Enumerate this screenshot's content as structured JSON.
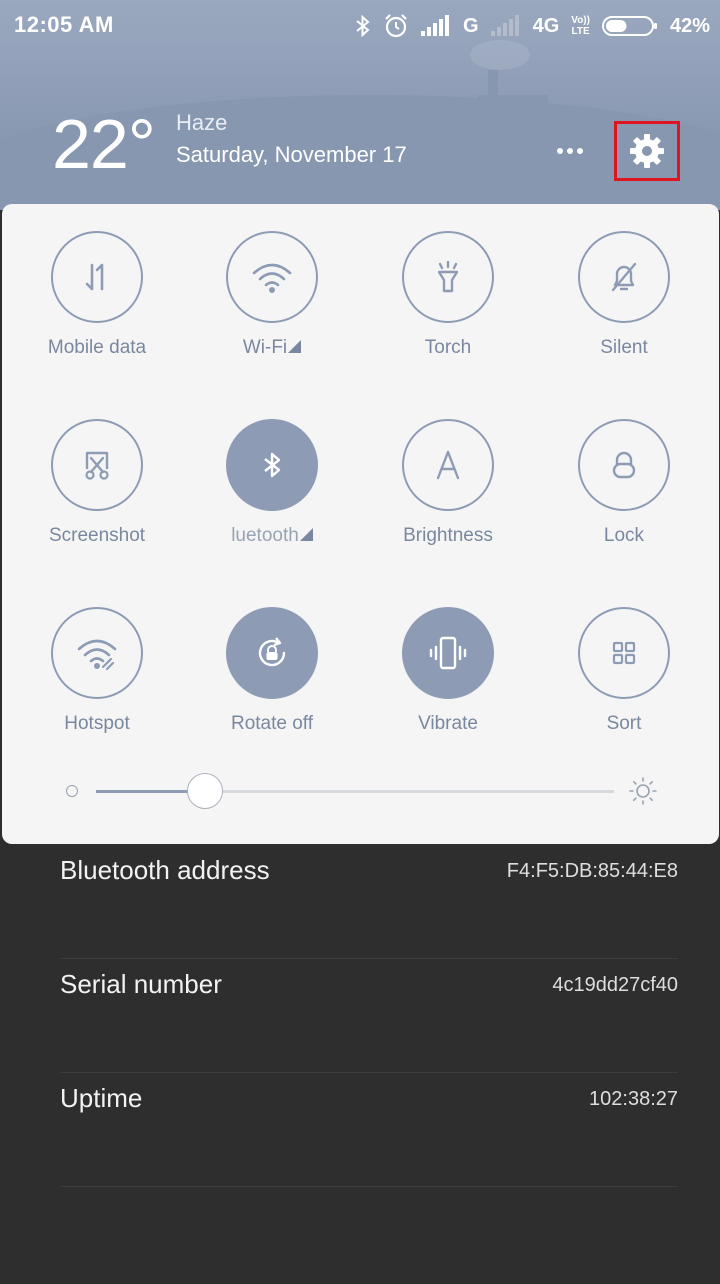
{
  "status_bar": {
    "time": "12:05 AM",
    "network_1": "G",
    "network_2": "4G",
    "volte_top": "Vo))",
    "volte_bottom": "LTE",
    "battery_percent": "42%",
    "battery_level": 0.42
  },
  "header": {
    "temperature": "22°",
    "condition": "Haze",
    "date": "Saturday, November 17"
  },
  "toggles": [
    {
      "label": "Mobile data",
      "icon": "mobile-data-icon",
      "active": false,
      "triangle": false
    },
    {
      "label": "Wi-Fi",
      "icon": "wifi-icon",
      "active": false,
      "triangle": true
    },
    {
      "label": "Torch",
      "icon": "torch-icon",
      "active": false,
      "triangle": false
    },
    {
      "label": "Silent",
      "icon": "silent-bell-icon",
      "active": false,
      "triangle": false
    },
    {
      "label": "Screenshot",
      "icon": "screenshot-scissors-icon",
      "active": false,
      "triangle": false
    },
    {
      "label": "luetooth",
      "icon": "bluetooth-icon",
      "active": true,
      "triangle": true
    },
    {
      "label": "Brightness",
      "icon": "brightness-a-icon",
      "active": false,
      "triangle": false
    },
    {
      "label": "Lock",
      "icon": "lock-icon",
      "active": false,
      "triangle": false
    },
    {
      "label": "Hotspot",
      "icon": "hotspot-icon",
      "active": false,
      "triangle": false
    },
    {
      "label": "Rotate off",
      "icon": "rotate-lock-icon",
      "active": true,
      "triangle": false
    },
    {
      "label": "Vibrate",
      "icon": "vibrate-icon",
      "active": true,
      "triangle": false
    },
    {
      "label": "Sort",
      "icon": "sort-grid-icon",
      "active": false,
      "triangle": false
    }
  ],
  "brightness": {
    "value": 0.21
  },
  "info_rows": [
    {
      "label": "Bluetooth address",
      "value": "F4:F5:DB:85:44:E8"
    },
    {
      "label": "Serial number",
      "value": "4c19dd27cf40"
    },
    {
      "label": "Uptime",
      "value": "102:38:27"
    }
  ],
  "colors": {
    "accent": "#8d9cb4",
    "highlight_box": "#e0141e",
    "panel": "#f5f5f5",
    "background": "#2e2e2e"
  }
}
